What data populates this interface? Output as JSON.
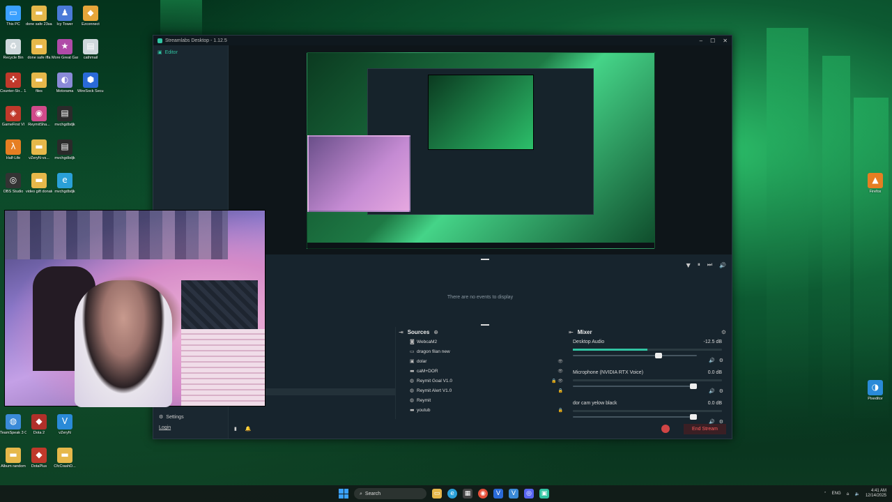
{
  "desktop": {
    "icons": [
      {
        "label": "This PC",
        "icon": "computer-icon",
        "color": "#3aa0ff"
      },
      {
        "label": "done safe 23sasa",
        "icon": "folder-icon",
        "color": "#e6b84a"
      },
      {
        "label": "Icy Tower",
        "icon": "game-icon",
        "color": "#4a7ad8"
      },
      {
        "label": "Ezconnect",
        "icon": "app-icon",
        "color": "#e6a63a"
      },
      {
        "label": "Recycle Bin",
        "icon": "recycle-bin-icon",
        "color": "#cfd8dc"
      },
      {
        "label": "done safe iffa",
        "icon": "folder-icon",
        "color": "#e6b84a"
      },
      {
        "label": "More Great Games",
        "icon": "games-icon",
        "color": "#b04aa8"
      },
      {
        "label": "cathmail",
        "icon": "file-icon",
        "color": "#cfd8dc"
      },
      {
        "label": "Counter-Str... 1.6",
        "icon": "cs-icon",
        "color": "#c0392b"
      },
      {
        "label": "files",
        "icon": "folder-icon",
        "color": "#e6b84a"
      },
      {
        "label": "Motorama",
        "icon": "motorama-icon",
        "color": "#8a8ad8"
      },
      {
        "label": "WireSock Secure ...",
        "icon": "wiresock-icon",
        "color": "#2a6ad8"
      },
      {
        "label": "GameFirst VI",
        "icon": "gamefirst-icon",
        "color": "#c0392b"
      },
      {
        "label": "ReymitSha...",
        "icon": "reymit-icon",
        "color": "#d04a8a"
      },
      {
        "label": "mvchgdbdjk",
        "icon": "file-icon",
        "color": "#2a2a2a"
      },
      {
        "label": "Half-Life",
        "icon": "half-life-icon",
        "color": "#e67e22"
      },
      {
        "label": "vZeryN-vs...",
        "icon": "folder-icon",
        "color": "#e6b84a"
      },
      {
        "label": "mvchgdbdjk",
        "icon": "file-icon",
        "color": "#2a2a2a"
      },
      {
        "label": "OBS Studio",
        "icon": "obs-icon",
        "color": "#333"
      },
      {
        "label": "video gift donate",
        "icon": "folder-icon",
        "color": "#e6b84a"
      },
      {
        "label": "mvchgdbdjk",
        "icon": "edge-icon",
        "color": "#2aa0d8"
      },
      {
        "label": "TeamSpeak 3 Client",
        "icon": "teamspeak-icon",
        "color": "#3a8ad8"
      },
      {
        "label": "Dota 2",
        "icon": "dota-icon",
        "color": "#b0302a"
      },
      {
        "label": "vZeryN",
        "icon": "vzeryn-icon",
        "color": "#2a8ad8"
      },
      {
        "label": "Album random",
        "icon": "folder-icon",
        "color": "#e6b84a"
      },
      {
        "label": "DotaPlus",
        "icon": "dotaplus-icon",
        "color": "#c0392b"
      },
      {
        "label": "CfcCrashD...",
        "icon": "folder-icon",
        "color": "#e6b84a"
      },
      {
        "label": "Firefox",
        "icon": "firefox-icon",
        "color": "#e67e22"
      },
      {
        "label": "Pixeditor",
        "icon": "pixeditor-icon",
        "color": "#2a8ad8"
      }
    ]
  },
  "window": {
    "title": "Streamlabs Desktop - 1.12.5",
    "sidebar": {
      "editor_label": "Editor",
      "settings_label": "Settings",
      "login_label": "Login"
    },
    "events": {
      "empty_text": "There are no events to display"
    },
    "sources": {
      "title": "Sources",
      "items": [
        {
          "name": "WebcaM2",
          "icon": "camera-icon",
          "flags": ""
        },
        {
          "name": "dragon filan new",
          "icon": "monitor-icon",
          "flags": ""
        },
        {
          "name": "dolar",
          "icon": "image-icon",
          "flags": "👁"
        },
        {
          "name": "caM+DOR",
          "icon": "folder-icon",
          "flags": "👁"
        },
        {
          "name": "Reymit Goal V1.0",
          "icon": "browser-icon",
          "flags": "🔒 👁"
        },
        {
          "name": "Reymit Alert V1.0",
          "icon": "browser-icon",
          "flags": "🔒"
        },
        {
          "name": "Reymit",
          "icon": "browser-icon",
          "flags": ""
        },
        {
          "name": "youtub",
          "icon": "folder-icon",
          "flags": "🔒"
        }
      ]
    },
    "mixer": {
      "title": "Mixer",
      "items": [
        {
          "name": "Desktop Audio",
          "db": "-12.5 dB",
          "level": 0.5,
          "volume": 0.72
        },
        {
          "name": "Microphone (NVIDIA RTX Voice)",
          "db": "0.0 dB",
          "level": 0,
          "volume": 1.0
        },
        {
          "name": "dor cam yelow black",
          "db": "0.0 dB",
          "level": 0,
          "volume": 1.0
        }
      ]
    },
    "footer": {
      "end_stream_label": "End Stream"
    }
  },
  "taskbar": {
    "search_placeholder": "Search",
    "lang": "ENG",
    "time": "4:41 AM",
    "date": "12/14/2025"
  }
}
